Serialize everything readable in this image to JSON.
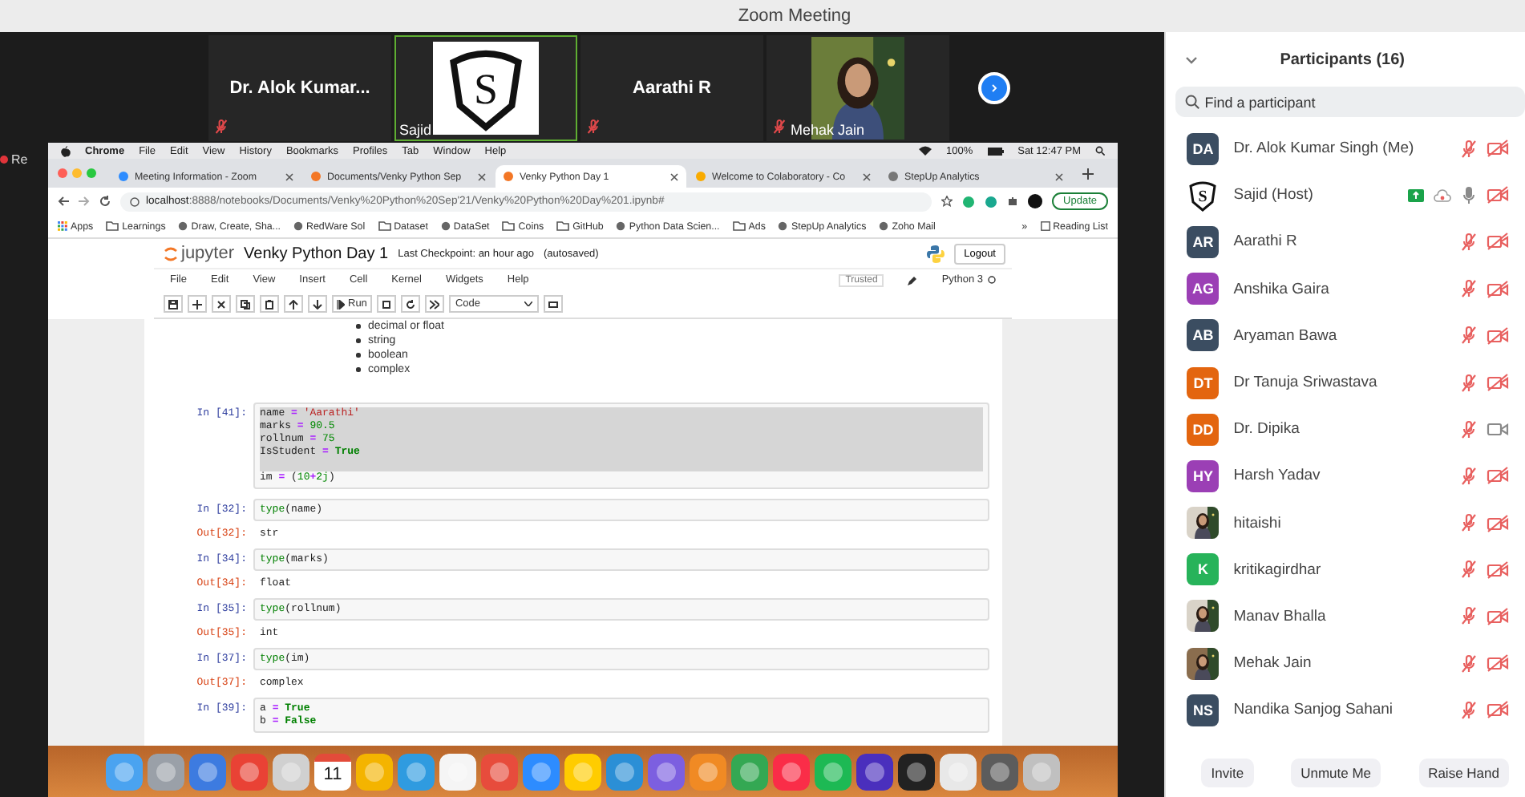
{
  "window": {
    "title": "Zoom Meeting"
  },
  "video_strip": {
    "tiles": [
      {
        "name": "Dr. Alok Kumar...",
        "kind": "name",
        "muted": true,
        "speaking": false
      },
      {
        "name": "Sajid",
        "kind": "logo",
        "logo_letter": "S",
        "muted": false,
        "speaking": true
      },
      {
        "name": "Aarathi R",
        "kind": "name",
        "muted": true,
        "speaking": false
      },
      {
        "name": "Mehak Jain",
        "muted": true,
        "speaking": false
      }
    ]
  },
  "recording_label": "Re",
  "mac_menu": {
    "items": [
      "Chrome",
      "File",
      "Edit",
      "View",
      "History",
      "Bookmarks",
      "Profiles",
      "Tab",
      "Window",
      "Help"
    ],
    "battery": "100%",
    "clock": "Sat 12:47 PM"
  },
  "browser": {
    "tabs": [
      {
        "title": "Meeting Information - Zoom",
        "selected": false,
        "color": "#2d8cff"
      },
      {
        "title": "Documents/Venky Python Sep",
        "selected": false,
        "color": "#f37726"
      },
      {
        "title": "Venky Python Day 1",
        "selected": true,
        "color": "#f37726"
      },
      {
        "title": "Welcome to Colaboratory - Co",
        "selected": false,
        "color": "#f9ab00"
      },
      {
        "title": "StepUp Analytics",
        "selected": false,
        "color": "#777777"
      }
    ],
    "address": {
      "host": "localhost",
      "path": ":8888/notebooks/Documents/Venky%20Python%20Sep'21/Venky%20Python%20Day%201.ipynb#"
    },
    "update_button": "Update",
    "bookmarks": [
      {
        "label": "Apps",
        "kind": "apps"
      },
      {
        "label": "Learnings",
        "kind": "folder"
      },
      {
        "label": "Draw, Create, Sha...",
        "kind": "site"
      },
      {
        "label": "RedWare Sol",
        "kind": "site"
      },
      {
        "label": "Dataset",
        "kind": "folder"
      },
      {
        "label": "DataSet",
        "kind": "site"
      },
      {
        "label": "Coins",
        "kind": "folder"
      },
      {
        "label": "GitHub",
        "kind": "folder"
      },
      {
        "label": "Python Data Scien...",
        "kind": "site"
      },
      {
        "label": "Ads",
        "kind": "folder"
      },
      {
        "label": "StepUp Analytics",
        "kind": "site"
      },
      {
        "label": "Zoho Mail",
        "kind": "site"
      }
    ],
    "more": "»",
    "reading_list": "Reading List"
  },
  "jupyter": {
    "logo_text": "jupyter",
    "title": "Venky Python Day 1",
    "checkpoint": "Last Checkpoint: an hour ago",
    "autosaved": "(autosaved)",
    "logout": "Logout",
    "menu": [
      "File",
      "Edit",
      "View",
      "Insert",
      "Cell",
      "Kernel",
      "Widgets",
      "Help"
    ],
    "trusted": "Trusted",
    "kernel": "Python 3",
    "run_label": "Run",
    "cell_type": "Code",
    "bullets": [
      "decimal or float",
      "string",
      "boolean",
      "complex"
    ],
    "cells": [
      {
        "prompt": "In [41]:",
        "lines": [
          {
            "selected": true,
            "tokens": [
              {
                "text": "name ",
                "kind": "plain"
              },
              {
                "text": "=",
                "kind": "operator"
              },
              {
                "text": " 'Aarathi'",
                "kind": "string"
              }
            ]
          },
          {
            "selected": true,
            "tokens": [
              {
                "text": "marks ",
                "kind": "plain"
              },
              {
                "text": "=",
                "kind": "operator"
              },
              {
                "text": " 90.5",
                "kind": "number"
              }
            ]
          },
          {
            "selected": true,
            "tokens": [
              {
                "text": "rollnum ",
                "kind": "plain"
              },
              {
                "text": "=",
                "kind": "operator"
              },
              {
                "text": " 75",
                "kind": "number"
              }
            ]
          },
          {
            "selected": true,
            "tokens": [
              {
                "text": "IsStudent ",
                "kind": "plain"
              },
              {
                "text": "=",
                "kind": "operator"
              },
              {
                "text": " True",
                "kind": "keyword"
              }
            ]
          },
          {
            "selected": true
          },
          {
            "selected": false,
            "tokens": [
              {
                "text": "im ",
                "kind": "plain"
              },
              {
                "text": "=",
                "kind": "operator"
              },
              {
                "text": " (",
                "kind": "plain"
              },
              {
                "text": "10",
                "kind": "number"
              },
              {
                "text": "+",
                "kind": "operator"
              },
              {
                "text": "2j",
                "kind": "number"
              },
              {
                "text": ")",
                "kind": "plain"
              }
            ]
          }
        ]
      },
      {
        "prompt": "In [32]:",
        "lines": [
          {
            "selected": false,
            "tokens": [
              {
                "text": "type",
                "kind": "builtin"
              },
              {
                "text": "(name)",
                "kind": "plain"
              }
            ]
          }
        ],
        "output_prompt": "Out[32]:",
        "output": "str"
      },
      {
        "prompt": "In [34]:",
        "lines": [
          {
            "selected": false,
            "tokens": [
              {
                "text": "type",
                "kind": "builtin"
              },
              {
                "text": "(marks)",
                "kind": "plain"
              }
            ]
          }
        ],
        "output_prompt": "Out[34]:",
        "output": "float"
      },
      {
        "prompt": "In [35]:",
        "lines": [
          {
            "selected": false,
            "tokens": [
              {
                "text": "type",
                "kind": "builtin"
              },
              {
                "text": "(rollnum)",
                "kind": "plain"
              }
            ]
          }
        ],
        "output_prompt": "Out[35]:",
        "output": "int"
      },
      {
        "prompt": "In [37]:",
        "lines": [
          {
            "selected": false,
            "tokens": [
              {
                "text": "type",
                "kind": "builtin"
              },
              {
                "text": "(im)",
                "kind": "plain"
              }
            ]
          }
        ],
        "output_prompt": "Out[37]:",
        "output": "complex"
      },
      {
        "prompt": "In [39]:",
        "lines": [
          {
            "selected": false,
            "tokens": [
              {
                "text": "a ",
                "kind": "plain"
              },
              {
                "text": "=",
                "kind": "operator"
              },
              {
                "text": " True",
                "kind": "keyword"
              }
            ]
          },
          {
            "selected": false,
            "tokens": [
              {
                "text": "b ",
                "kind": "plain"
              },
              {
                "text": "=",
                "kind": "operator"
              },
              {
                "text": " False",
                "kind": "keyword"
              }
            ]
          }
        ]
      }
    ]
  },
  "dock": {
    "calendar_day": "11"
  },
  "participants": {
    "title": "Participants (16)",
    "search": {
      "placeholder": "Find a participant"
    },
    "items": [
      {
        "name": "Dr. Alok Kumar Singh (Me)",
        "avatar": {
          "kind": "initials",
          "initials": "DA",
          "color": "#3b4d61"
        },
        "muted": true,
        "video": false,
        "sharing": false,
        "recording": false
      },
      {
        "name": "Sajid (Host)",
        "avatar": {
          "kind": "logo",
          "letter": "S"
        },
        "muted": false,
        "video": false,
        "sharing": true,
        "recording": true
      },
      {
        "name": "Aarathi R",
        "avatar": {
          "kind": "initials",
          "initials": "AR",
          "color": "#3b4d61"
        },
        "muted": true,
        "video": false,
        "sharing": false,
        "recording": false
      },
      {
        "name": "Anshika Gaira",
        "avatar": {
          "kind": "initials",
          "initials": "AG",
          "color": "#9b3fb5"
        },
        "muted": true,
        "video": false,
        "sharing": false,
        "recording": false
      },
      {
        "name": "Aryaman Bawa",
        "avatar": {
          "kind": "initials",
          "initials": "AB",
          "color": "#3b4d61"
        },
        "muted": true,
        "video": false,
        "sharing": false,
        "recording": false
      },
      {
        "name": "Dr Tanuja Sriwastava",
        "avatar": {
          "kind": "initials",
          "initials": "DT",
          "color": "#e3650f"
        },
        "muted": true,
        "video": false,
        "sharing": false,
        "recording": false
      },
      {
        "name": "Dr. Dipika",
        "avatar": {
          "kind": "initials",
          "initials": "DD",
          "color": "#e3650f"
        },
        "muted": true,
        "video": true,
        "sharing": false,
        "recording": false
      },
      {
        "name": "Harsh Yadav",
        "avatar": {
          "kind": "initials",
          "initials": "HY",
          "color": "#9b3fb5"
        },
        "muted": true,
        "video": false,
        "sharing": false,
        "recording": false
      },
      {
        "name": "hitaishi",
        "muted": true,
        "video": false,
        "sharing": false,
        "recording": false
      },
      {
        "name": "kritikagirdhar",
        "avatar": {
          "kind": "initials",
          "initials": "K",
          "color": "#27b35a"
        },
        "muted": true,
        "video": false,
        "sharing": false,
        "recording": false
      },
      {
        "name": "Manav Bhalla",
        "muted": true,
        "video": false,
        "sharing": false,
        "recording": false
      },
      {
        "name": "Mehak Jain",
        "muted": true,
        "video": false,
        "sharing": false,
        "recording": false
      },
      {
        "name": "Nandika Sanjog Sahani",
        "avatar": {
          "kind": "initials",
          "initials": "NS",
          "color": "#3b4d61"
        },
        "muted": true,
        "video": false,
        "sharing": false,
        "recording": false
      }
    ],
    "buttons": [
      "Invite",
      "Unmute Me",
      "Raise Hand"
    ]
  }
}
